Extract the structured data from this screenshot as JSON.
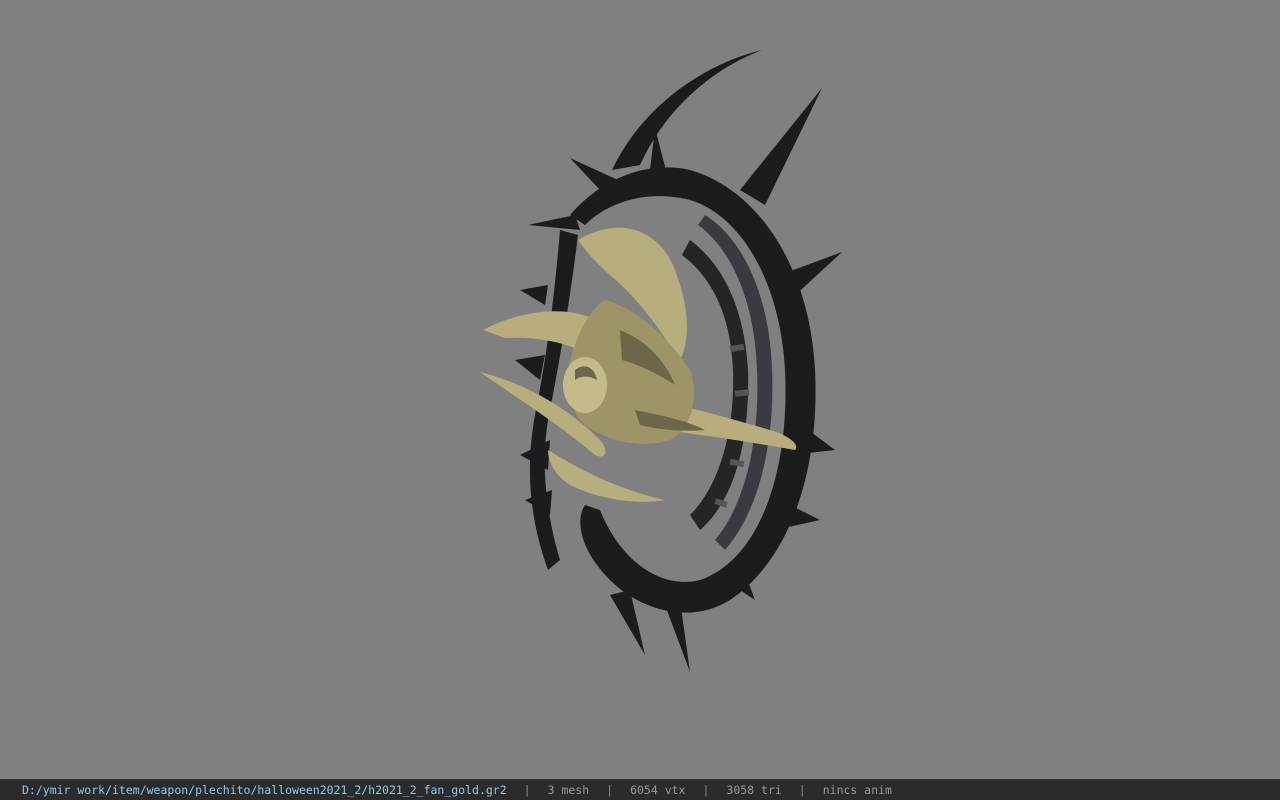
{
  "viewport": {
    "background_color": "#808080",
    "model_colors": {
      "frame": "#1c1c1e",
      "frame_highlight": "#3a3a40",
      "gold": "#b8ad7c",
      "gold_shadow": "#6e6648"
    }
  },
  "status_bar": {
    "file_path": "D:/ymir work/item/weapon/plechito/halloween2021_2/h2021_2_fan_gold.gr2",
    "separator": "|",
    "mesh_count": "3 mesh",
    "vertex_count": "6054 vtx",
    "triangle_count": "3058 tri",
    "anim_status": "nincs anim",
    "path_color": "#8fc8f0",
    "background_color": "#2b2b2b"
  }
}
